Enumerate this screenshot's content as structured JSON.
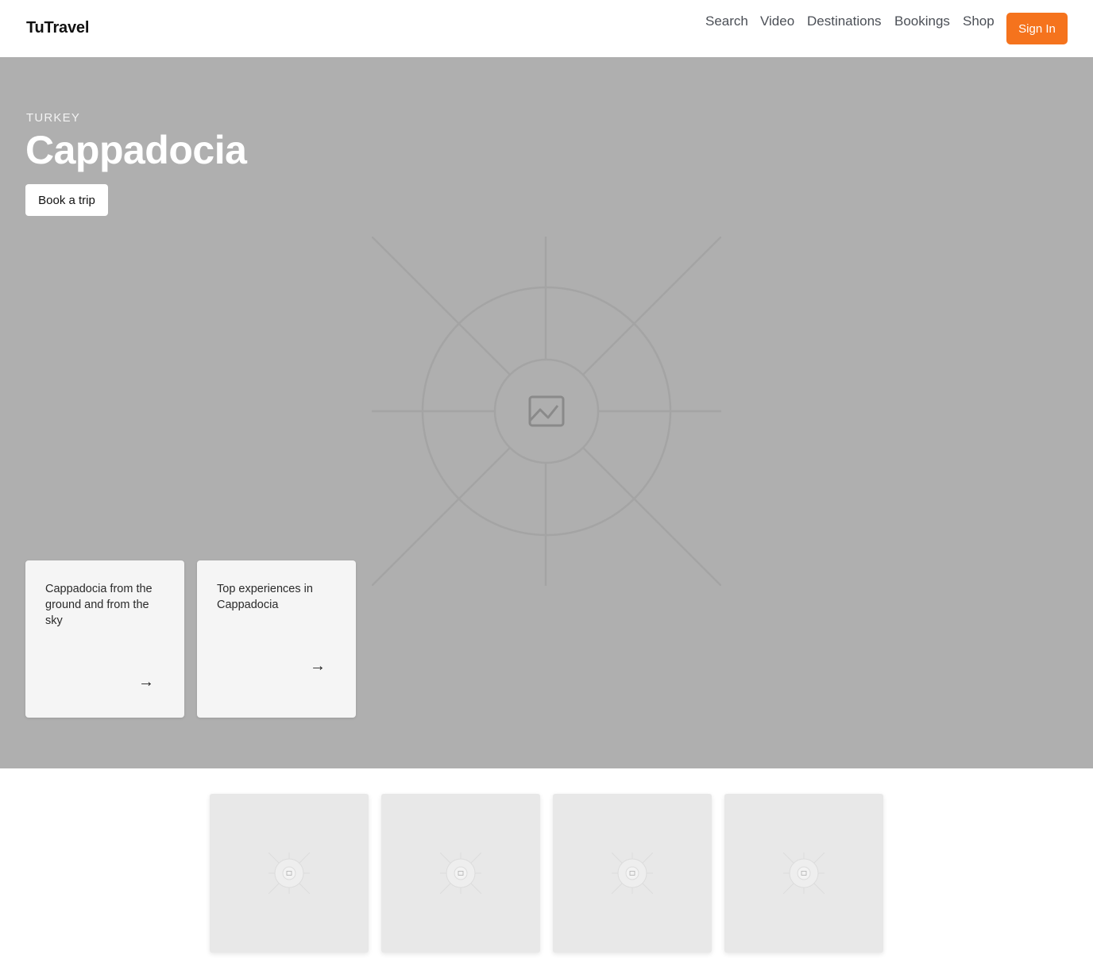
{
  "header": {
    "brand": "TuTravel",
    "nav": [
      "Search",
      "Video",
      "Destinations",
      "Bookings",
      "Shop"
    ],
    "signin_label": "Sign In"
  },
  "hero": {
    "eyebrow": "TURKEY",
    "title": "Cappadocia",
    "cta_label": "Book a trip",
    "image_icon": "image-placeholder-icon",
    "cards": [
      {
        "text": "Cappadocia from the ground and from the sky",
        "arrow": "→"
      },
      {
        "text": "Top experiences in Cappadocia",
        "arrow": "→"
      }
    ]
  },
  "thumbnails": {
    "count_icons": [
      "image-placeholder-icon",
      "image-placeholder-icon",
      "image-placeholder-icon",
      "image-placeholder-icon"
    ]
  },
  "colors": {
    "accent": "#f5731d",
    "hero_bg": "#afafaf",
    "card_bg": "#f5f5f5",
    "thumb_bg": "#e8e8e8"
  }
}
